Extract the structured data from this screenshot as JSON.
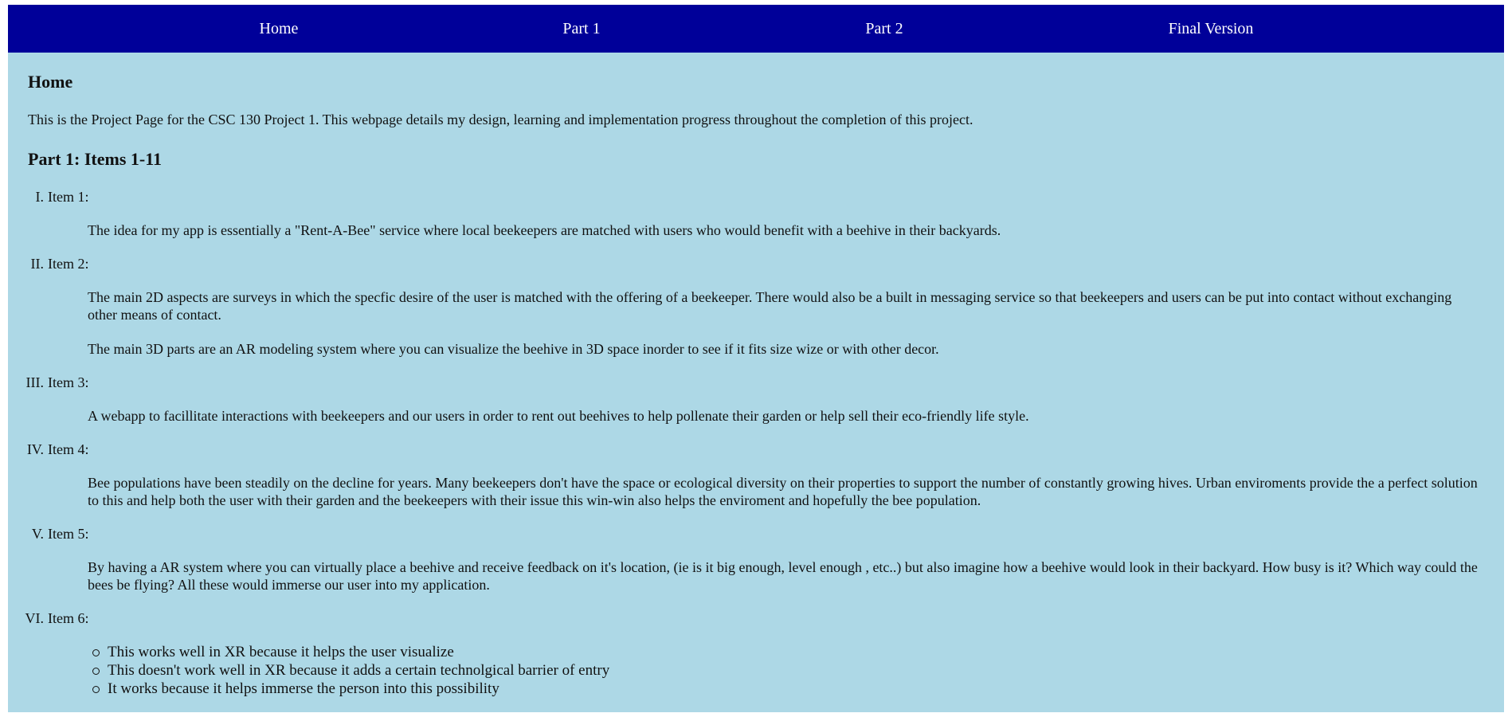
{
  "nav": {
    "items": [
      "Home",
      "Part 1",
      "Part 2",
      "Final Version"
    ]
  },
  "home": {
    "heading": "Home",
    "intro": "This is the Project Page for the CSC 130 Project 1. This webpage details my design, learning and implementation progress throughout the completion of this project."
  },
  "part1": {
    "heading": "Part 1: Items 1-11",
    "items": [
      {
        "numeral": "I.",
        "label": "Item 1:",
        "paragraphs": [
          "The idea for my app is essentially a \"Rent-A-Bee\" service where local beekeepers are matched with users who would benefit with a beehive in their backyards."
        ]
      },
      {
        "numeral": "II.",
        "label": "Item 2:",
        "paragraphs": [
          "The main 2D aspects are surveys in which the specfic desire of the user is matched with the offering of a beekeeper. There would also be a built in messaging service so that beekeepers and users can be put into contact without exchanging other means of contact.",
          "The main 3D parts are an AR modeling system where you can visualize the beehive in 3D space inorder to see if it fits size wize or with other decor."
        ]
      },
      {
        "numeral": "III.",
        "label": "Item 3:",
        "paragraphs": [
          "A webapp to facillitate interactions with beekeepers and our users in order to rent out beehives to help pollenate their garden or help sell their eco-friendly life style."
        ]
      },
      {
        "numeral": "IV.",
        "label": "Item 4:",
        "paragraphs": [
          "Bee populations have been steadily on the decline for years. Many beekeepers don't have the space or ecological diversity on their properties to support the number of constantly growing hives. Urban enviroments provide the a perfect solution to this and help both the user with their garden and the beekeepers with their issue this win-win also helps the enviroment and hopefully the bee population."
        ]
      },
      {
        "numeral": "V.",
        "label": "Item 5:",
        "paragraphs": [
          "By having a AR system where you can virtually place a beehive and receive feedback on it's location, (ie is it big enough, level enough , etc..) but also imagine how a beehive would look in their backyard. How busy is it? Which way could the bees be flying? All these would immerse our user into my application."
        ]
      },
      {
        "numeral": "VI.",
        "label": "Item 6:",
        "bullets": [
          "This works well in XR because it helps the user visualize",
          "This doesn't work well in XR because it adds a certain technolgical barrier of entry",
          "It works because it helps immerse the person into this possibility"
        ]
      }
    ]
  },
  "colors": {
    "nav_background": "#000099",
    "page_background": "#add8e6",
    "nav_text": "#ffffff"
  }
}
